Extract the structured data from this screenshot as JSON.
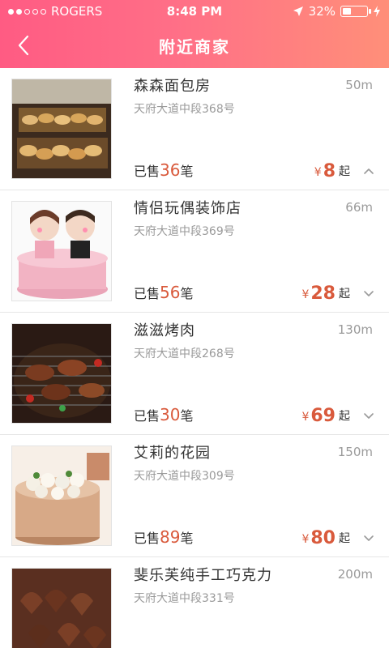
{
  "status_bar": {
    "carrier": "ROGERS",
    "time": "8:48 PM",
    "battery": "32%"
  },
  "header": {
    "title": "附近商家"
  },
  "items": [
    {
      "name": "森森面包房",
      "address": "天府大道中段368号",
      "distance": "50m",
      "sales_prefix": "已售",
      "sales": "36",
      "sales_suffix": "笔",
      "currency": "¥",
      "price": "8",
      "price_suffix": "起",
      "chevron": "chevron-up-icon"
    },
    {
      "name": "情侣玩偶装饰店",
      "address": "天府大道中段369号",
      "distance": "66m",
      "sales_prefix": "已售",
      "sales": "56",
      "sales_suffix": "笔",
      "currency": "¥",
      "price": "28",
      "price_suffix": "起",
      "chevron": "chevron-down-icon"
    },
    {
      "name": "滋滋烤肉",
      "address": "天府大道中段268号",
      "distance": "130m",
      "sales_prefix": "已售",
      "sales": "30",
      "sales_suffix": "笔",
      "currency": "¥",
      "price": "69",
      "price_suffix": "起",
      "chevron": "chevron-down-icon"
    },
    {
      "name": "艾莉的花园",
      "address": "天府大道中段309号",
      "distance": "150m",
      "sales_prefix": "已售",
      "sales": "89",
      "sales_suffix": "笔",
      "currency": "¥",
      "price": "80",
      "price_suffix": "起",
      "chevron": "chevron-down-icon"
    },
    {
      "name": "斐乐芙纯手工巧克力",
      "address": "天府大道中段331号",
      "distance": "200m"
    }
  ]
}
